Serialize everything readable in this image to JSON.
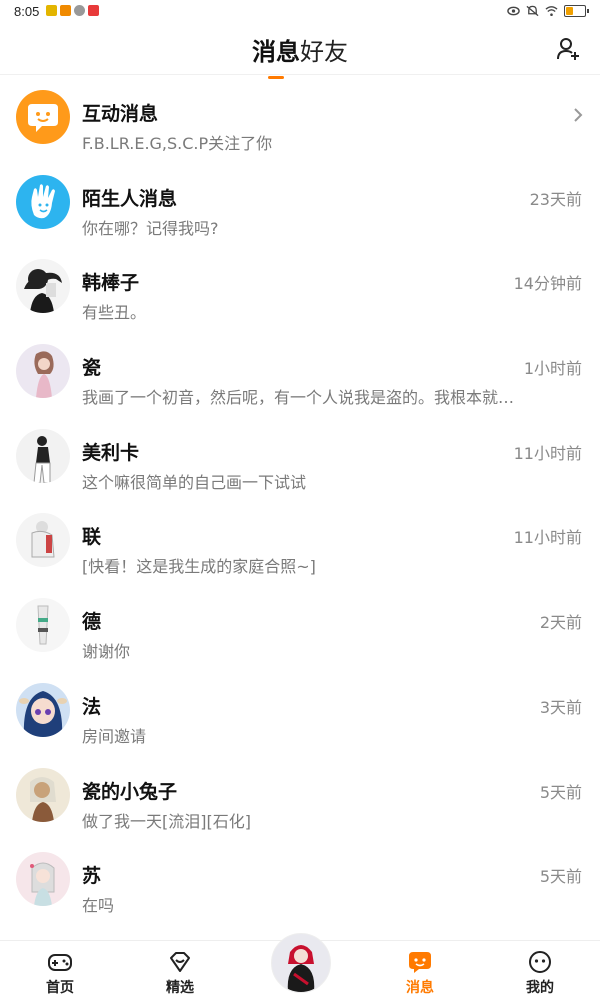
{
  "status_bar": {
    "time": "8:05",
    "app_icon_colors": [
      "#e3b500",
      "#f08a00",
      "#999999",
      "#e83a3a"
    ],
    "battery_color": "#f0a000"
  },
  "header": {
    "tabs": [
      {
        "label": "消息",
        "active": true
      },
      {
        "label": "好友",
        "active": false
      }
    ],
    "accent_color": "#ff7a00",
    "add_friend_icon": "add-user-icon"
  },
  "conversations": [
    {
      "name": "互动消息",
      "preview": "F.B.LR.E.G,S.C.P关注了你",
      "time": "",
      "avatar_icon": "speech-bubble-icon",
      "has_arrow": true
    },
    {
      "name": "陌生人消息",
      "preview": "你在哪？记得我吗?",
      "time": "23天前",
      "avatar_icon": "wave-hand-icon"
    },
    {
      "name": "韩棒子",
      "preview": "有些丑。",
      "time": "14分钟前"
    },
    {
      "name": "瓷",
      "preview": "我画了一个初音，然后呢，有一个人说我是盗的。我根本就没盗...",
      "time": "1小时前"
    },
    {
      "name": "美利卡",
      "preview": "这个嘛很简单的自己画一下试试",
      "time": "11小时前"
    },
    {
      "name": "联",
      "preview": "[快看！这是我生成的家庭合照~]",
      "time": "11小时前"
    },
    {
      "name": "德",
      "preview": "谢谢你",
      "time": "2天前"
    },
    {
      "name": "法",
      "preview": "房间邀请",
      "time": "3天前"
    },
    {
      "name": "瓷的小兔子",
      "preview": "做了我一天[流泪][石化]",
      "time": "5天前"
    },
    {
      "name": "苏",
      "preview": "在吗",
      "time": "5天前"
    }
  ],
  "bottom_nav": {
    "items": [
      {
        "label": "首页",
        "icon": "gamepad-icon"
      },
      {
        "label": "精选",
        "icon": "heart-gem-icon"
      },
      {
        "label": "消息",
        "icon": "chat-icon",
        "active": true
      },
      {
        "label": "我的",
        "icon": "face-icon"
      }
    ]
  }
}
